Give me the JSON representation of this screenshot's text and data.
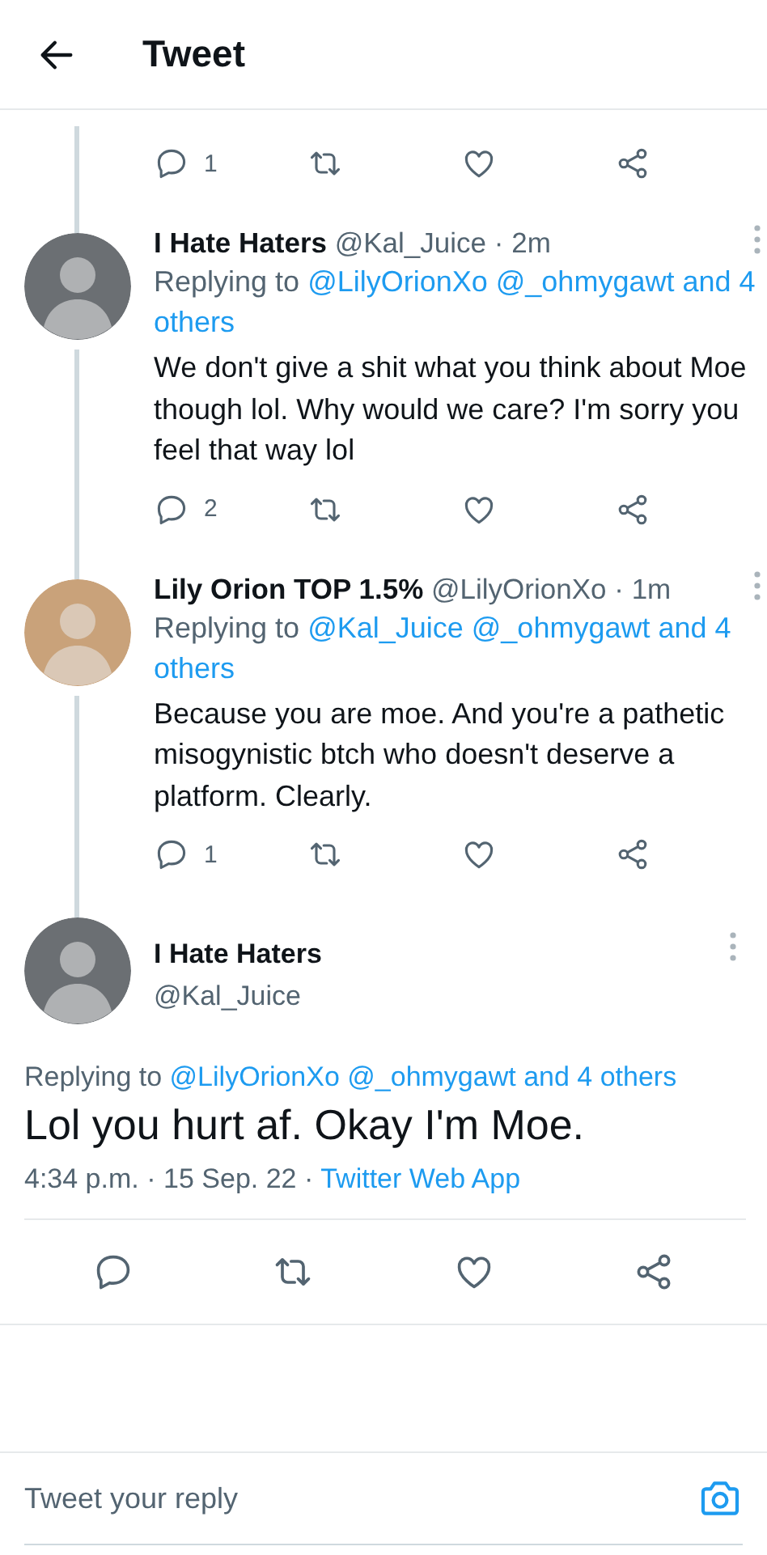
{
  "header": {
    "title": "Tweet"
  },
  "previous_actions": {
    "replies": "1"
  },
  "replies": [
    {
      "name": "I Hate Haters",
      "handle": "@Kal_Juice",
      "separator": "·",
      "time": "2m",
      "color": "#6b6f73",
      "replying_label": "Replying to",
      "mentions": "@LilyOrionXo @_ohmygawt and 4 others",
      "text": "We don't give a shit what you think about Moe though lol. Why would we care? I'm sorry you feel that way lol",
      "reply_count": "2"
    },
    {
      "name": "Lily Orion TOP 1.5%",
      "handle": "@LilyOrionXo",
      "separator": "·",
      "time": "1m",
      "color": "#c9a27a",
      "replying_label": "Replying to",
      "mentions": "@Kal_Juice @_ohmygawt and 4 others",
      "text": "Because you are moe. And you're a pathetic misogynistic btch who doesn't deserve a platform. Clearly.",
      "reply_count": "1"
    }
  ],
  "focused_tweet": {
    "name": "I Hate Haters",
    "handle": "@Kal_Juice",
    "color": "#6b6f73",
    "replying_label": "Replying to",
    "mentions": "@LilyOrionXo @_ohmygawt and 4 others",
    "text": "Lol you hurt af. Okay I'm Moe.",
    "time": "4:34 p.m.",
    "separator_1": "·",
    "date": "15 Sep. 22",
    "separator_2": "·",
    "source": "Twitter Web App"
  },
  "composer": {
    "placeholder": "Tweet your reply"
  }
}
